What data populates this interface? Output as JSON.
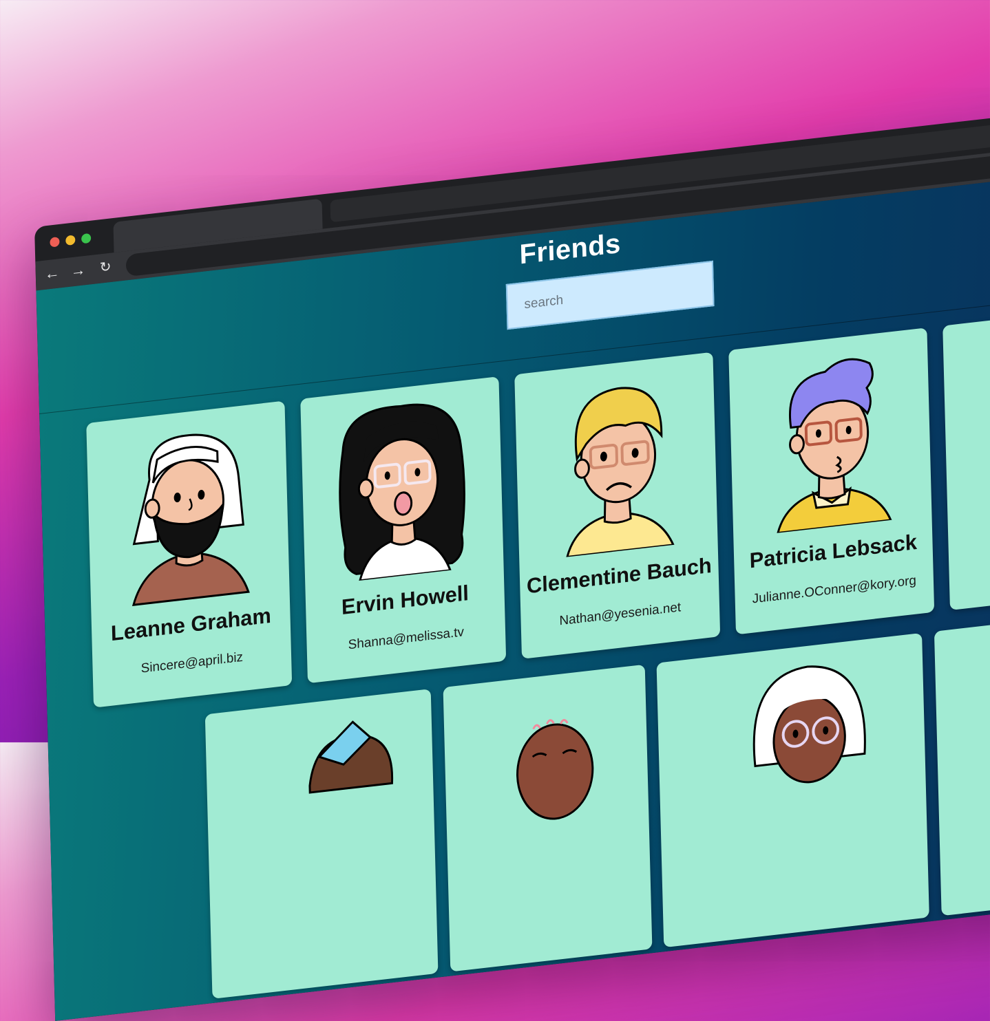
{
  "browser": {
    "nav": {
      "back_icon": "←",
      "forward_icon": "→",
      "reload_icon": "↻"
    }
  },
  "page": {
    "title": "Friends",
    "search": {
      "placeholder": "search",
      "value": ""
    }
  },
  "friends": [
    {
      "name": "Leanne Graham",
      "email": "Sincere@april.biz"
    },
    {
      "name": "Ervin Howell",
      "email": "Shanna@melissa.tv"
    },
    {
      "name": "Clementine Bauch",
      "email": "Nathan@yesenia.net"
    },
    {
      "name": "Patricia Lebsack",
      "email": "Julianne.OConner@kory.org"
    }
  ],
  "colors": {
    "card_background": "#a1ebd3",
    "search_background": "#cdeafe",
    "viewport_gradient_start": "#0a7a7b",
    "viewport_gradient_end": "#0b2f5c"
  }
}
